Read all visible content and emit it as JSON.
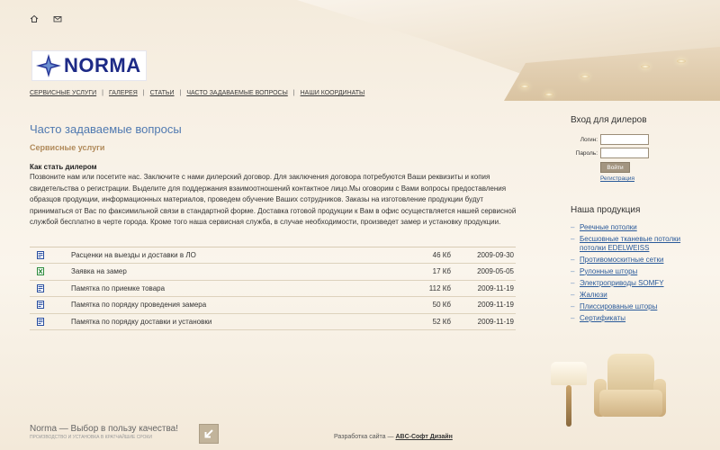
{
  "header": {
    "icons": [
      "home-icon",
      "mail-icon"
    ],
    "logo_text": "NORMA",
    "nav": [
      {
        "label": "СЕРВИСНЫЕ УСЛУГИ"
      },
      {
        "label": "ГАЛЕРЕЯ"
      },
      {
        "label": "СТАТЬИ"
      },
      {
        "label": "ЧАСТО ЗАДАВАЕМЫЕ ВОПРОСЫ"
      },
      {
        "label": "НАШИ КООРДИНАТЫ"
      }
    ],
    "nav_separator": "|"
  },
  "main": {
    "title": "Часто задаваемые вопросы",
    "section": "Сервисные услуги",
    "question": "Как стать дилером",
    "answer": "Позвоните нам или посетите нас. Заключите с нами дилерский договор. Для заключения договора потребуются Ваши реквизиты и копия свидетельства о регистрации. Выделите для поддержания взаимоотношений контактное лицо.Мы оговорим с Вами вопросы предоставления образцов продукции, информационных материалов, проведем обучение Ваших сотрудников. Заказы на изготовление продукции будут приниматься от Вас по факсимильной связи в стандартной форме. Доставка готовой продукции к Вам в офис осуществляется нашей сервисной службой бесплатно в черте города. Кроме того наша сервисная служба, в случае необходимости, произведет замер и установку продукции.",
    "files": [
      {
        "icon": "word-doc-icon",
        "name": "Расценки на выезды и доставки в ЛО",
        "size": "46 Кб",
        "date": "2009-09-30"
      },
      {
        "icon": "excel-doc-icon",
        "name": "Заявка на замер",
        "size": "17 Кб",
        "date": "2009-05-05"
      },
      {
        "icon": "word-doc-icon",
        "name": "Памятка по приемке товара",
        "size": "112 Кб",
        "date": "2009-11-19"
      },
      {
        "icon": "word-doc-icon",
        "name": "Памятка по порядку проведения замера",
        "size": "50 Кб",
        "date": "2009-11-19"
      },
      {
        "icon": "word-doc-icon",
        "name": "Памятка по порядку доставки и установки",
        "size": "52 Кб",
        "date": "2009-11-19"
      }
    ]
  },
  "sidebar": {
    "login": {
      "title": "Вход для дилеров",
      "login_label": "Логин:",
      "login_value": "",
      "password_label": "Пароль:",
      "password_value": "",
      "button": "Войти",
      "register": "Регистрация"
    },
    "products": {
      "title": "Наша продукция",
      "bullet": "–",
      "items": [
        {
          "label": "Реечные потолки"
        },
        {
          "label": "Бесшовные тканевые потолки потолки EDELWEISS"
        },
        {
          "label": "Противомоскитные сетки"
        },
        {
          "label": "Рулонные шторы"
        },
        {
          "label": "Электроприводы SOMFY"
        },
        {
          "label": "Жалюзи"
        },
        {
          "label": "Плиссированые шторы"
        },
        {
          "label": "Сертификаты"
        }
      ]
    }
  },
  "footer": {
    "slogan": "Norma — Выбор в пользу качества!",
    "tagline": "производство и установка в кратчайшие сроки",
    "dev_label": "Разработка сайта —",
    "dev_link": "ABC-Софт Дизайн"
  },
  "colors": {
    "title_blue": "#5079b0",
    "section_tan": "#b08a5a",
    "link_blue": "#2a5a9a",
    "logo_navy": "#1d2a86"
  }
}
